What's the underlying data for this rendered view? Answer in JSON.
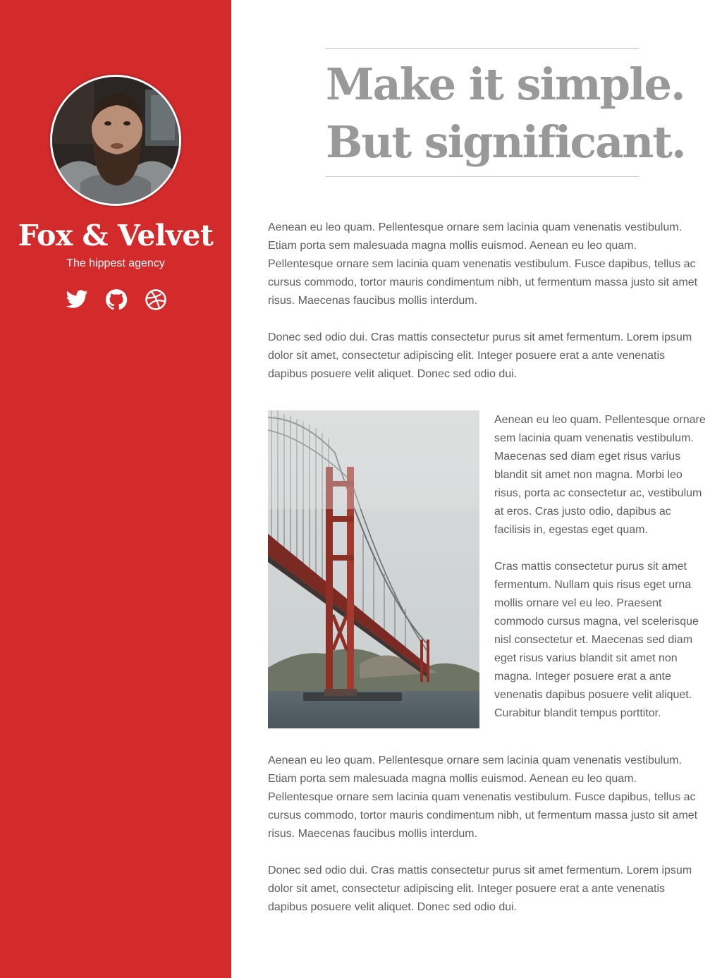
{
  "sidebar": {
    "brand_name": "Fox & Velvet",
    "tagline": "The hippest agency",
    "background_color": "#d32b2c",
    "social": [
      {
        "icon": "twitter-icon"
      },
      {
        "icon": "github-icon"
      },
      {
        "icon": "dribbble-icon"
      }
    ]
  },
  "hero": {
    "line1": "Make it simple.",
    "line2": "But significant."
  },
  "content": {
    "para1": "Aenean eu leo quam. Pellentesque ornare sem lacinia quam venenatis vestibulum. Etiam porta sem malesuada magna mollis euismod. Aenean eu leo quam. Pellentesque ornare sem lacinia quam venenatis vestibulum. Fusce dapibus, tellus ac cursus commodo, tortor mauris condimentum nibh, ut fermentum massa justo sit amet risus. Maecenas faucibus mollis interdum.",
    "para2": "Donec sed odio dui. Cras mattis consectetur purus sit amet fermentum. Lorem ipsum dolor sit amet, consectetur adipiscing elit. Integer posuere erat a ante venenatis dapibus posuere velit aliquet. Donec sed odio dui.",
    "side_para1": "Aenean eu leo quam. Pellentesque ornare sem lacinia quam venenatis vestibulum. Maecenas sed diam eget risus varius blandit sit amet non magna. Morbi leo risus, porta ac consectetur ac, vestibulum at eros. Cras justo odio, dapibus ac facilisis in, egestas eget quam.",
    "side_para2": "Cras mattis consectetur purus sit amet fermentum. Nullam quis risus eget urna mollis ornare vel eu leo. Praesent commodo cursus magna, vel scelerisque nisl consectetur et. Maecenas sed diam eget risus varius blandit sit amet non magna. Integer posuere erat a ante venenatis dapibus posuere velit aliquet. Curabitur blandit tempus porttitor.",
    "para3": "Aenean eu leo quam. Pellentesque ornare sem lacinia quam venenatis vestibulum. Etiam porta sem malesuada magna mollis euismod. Aenean eu leo quam. Pellentesque ornare sem lacinia quam venenatis vestibulum. Fusce dapibus, tellus ac cursus commodo, tortor mauris condimentum nibh, ut fermentum massa justo sit amet risus. Maecenas faucibus mollis interdum.",
    "para4": "Donec sed odio dui. Cras mattis consectetur purus sit amet fermentum. Lorem ipsum dolor sit amet, consectetur adipiscing elit. Integer posuere erat a ante venenatis dapibus posuere velit aliquet. Donec sed odio dui."
  }
}
